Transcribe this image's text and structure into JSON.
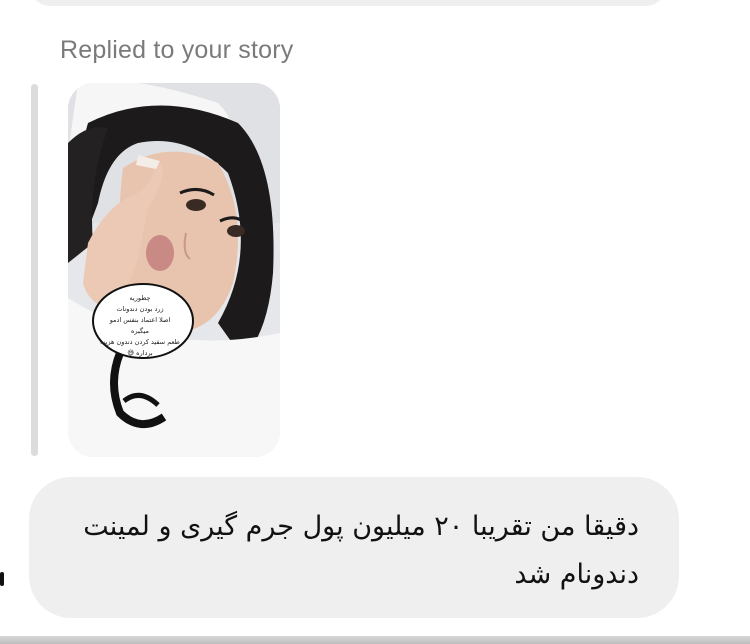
{
  "thread": {
    "reply_label": "Replied to your story",
    "story": {
      "sticker_lines": [
        "چطوریه",
        "زرد بودن دندونات",
        "اصلا اعتماد بنفس ادمو میگیره",
        "طعم سفید کردن دندون هزینه برداره 😅"
      ]
    },
    "message": {
      "text": "دقیقا من تقریبا ۲۰ میلیون پول جرم گیری و لمینت دندونام شد"
    }
  },
  "colors": {
    "bubble_background": "#efefef",
    "secondary_text": "#7a7a7a",
    "quote_bar": "#dcdcdc"
  }
}
